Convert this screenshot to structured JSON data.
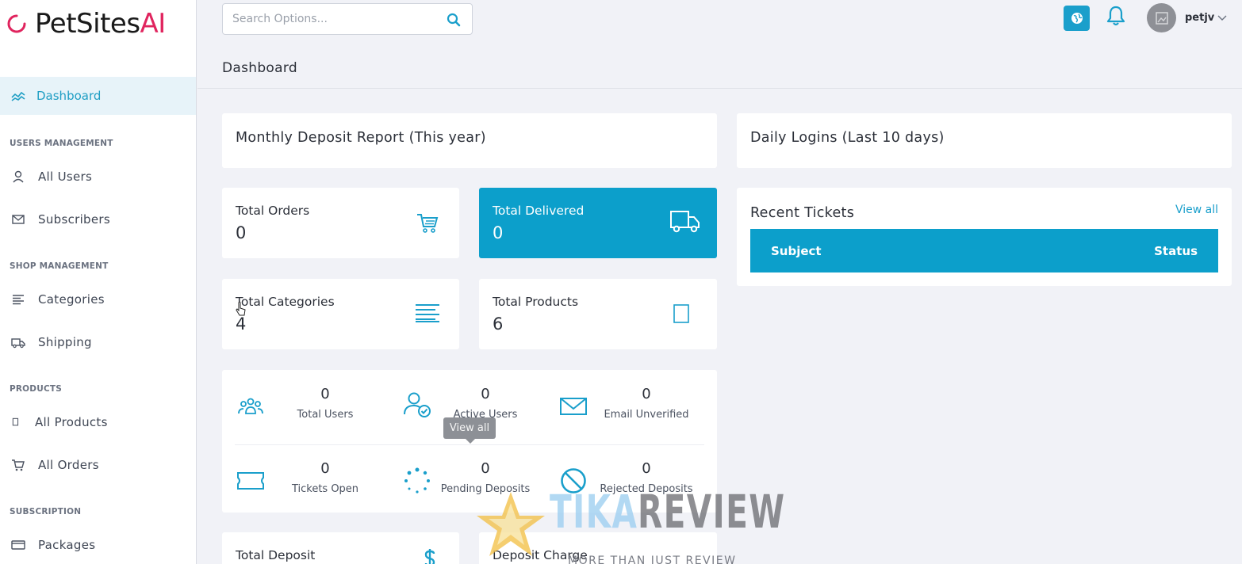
{
  "brand": {
    "name": "PetSites",
    "suffix": "AI",
    "accent": "#e0245e"
  },
  "sidebar": {
    "active": {
      "label": "Dashboard",
      "icon": "chart-line-icon"
    },
    "sections": [
      {
        "title": "USERS MANAGEMENT",
        "items": [
          {
            "label": "All Users",
            "icon": "user-icon"
          },
          {
            "label": "Subscribers",
            "icon": "mail-icon"
          }
        ]
      },
      {
        "title": "SHOP MANAGEMENT",
        "items": [
          {
            "label": "Categories",
            "icon": "list-icon"
          },
          {
            "label": "Shipping",
            "icon": "truck-icon"
          }
        ]
      },
      {
        "title": "PRODUCTS",
        "items": [
          {
            "label": "All Products",
            "icon": "square-icon"
          },
          {
            "label": "All Orders",
            "icon": "cart-icon"
          }
        ]
      },
      {
        "title": "SUBSCRIPTION",
        "items": [
          {
            "label": "Packages",
            "icon": "card-icon"
          }
        ]
      }
    ]
  },
  "topbar": {
    "search_placeholder": "Search Options...",
    "username": "petjv",
    "accent": "#1a9fcb"
  },
  "page_title": "Dashboard",
  "panels": {
    "monthly_deposit": "Monthly Deposit Report (This year)",
    "daily_logins": "Daily Logins (Last 10 days)",
    "recent_tickets": {
      "title": "Recent Tickets",
      "view_all": "View all",
      "columns": [
        "Subject",
        "Status"
      ]
    }
  },
  "stats": {
    "total_orders": {
      "label": "Total Orders",
      "value": "0"
    },
    "total_delivered": {
      "label": "Total Delivered",
      "value": "0"
    },
    "total_categories": {
      "label": "Total Categories",
      "value": "4"
    },
    "total_products": {
      "label": "Total Products",
      "value": "6"
    },
    "total_deposit": {
      "label": "Total Deposit"
    },
    "deposit_charge": {
      "label": "Deposit Charge"
    }
  },
  "mini_stats": {
    "total_users": {
      "value": "0",
      "label": "Total Users"
    },
    "active_users": {
      "value": "0",
      "label": "Active Users"
    },
    "email_unverified": {
      "value": "0",
      "label": "Email Unverified"
    },
    "tickets_open": {
      "value": "0",
      "label": "Tickets Open"
    },
    "pending_deposits": {
      "value": "0",
      "label": "Pending Deposits"
    },
    "rejected_deposits": {
      "value": "0",
      "label": "Rejected Deposits"
    }
  },
  "tooltip": "View all",
  "watermark": {
    "part1": "TIKA",
    "part2": "REVIEW",
    "tagline": "MORE THAN JUST REVIEW"
  }
}
